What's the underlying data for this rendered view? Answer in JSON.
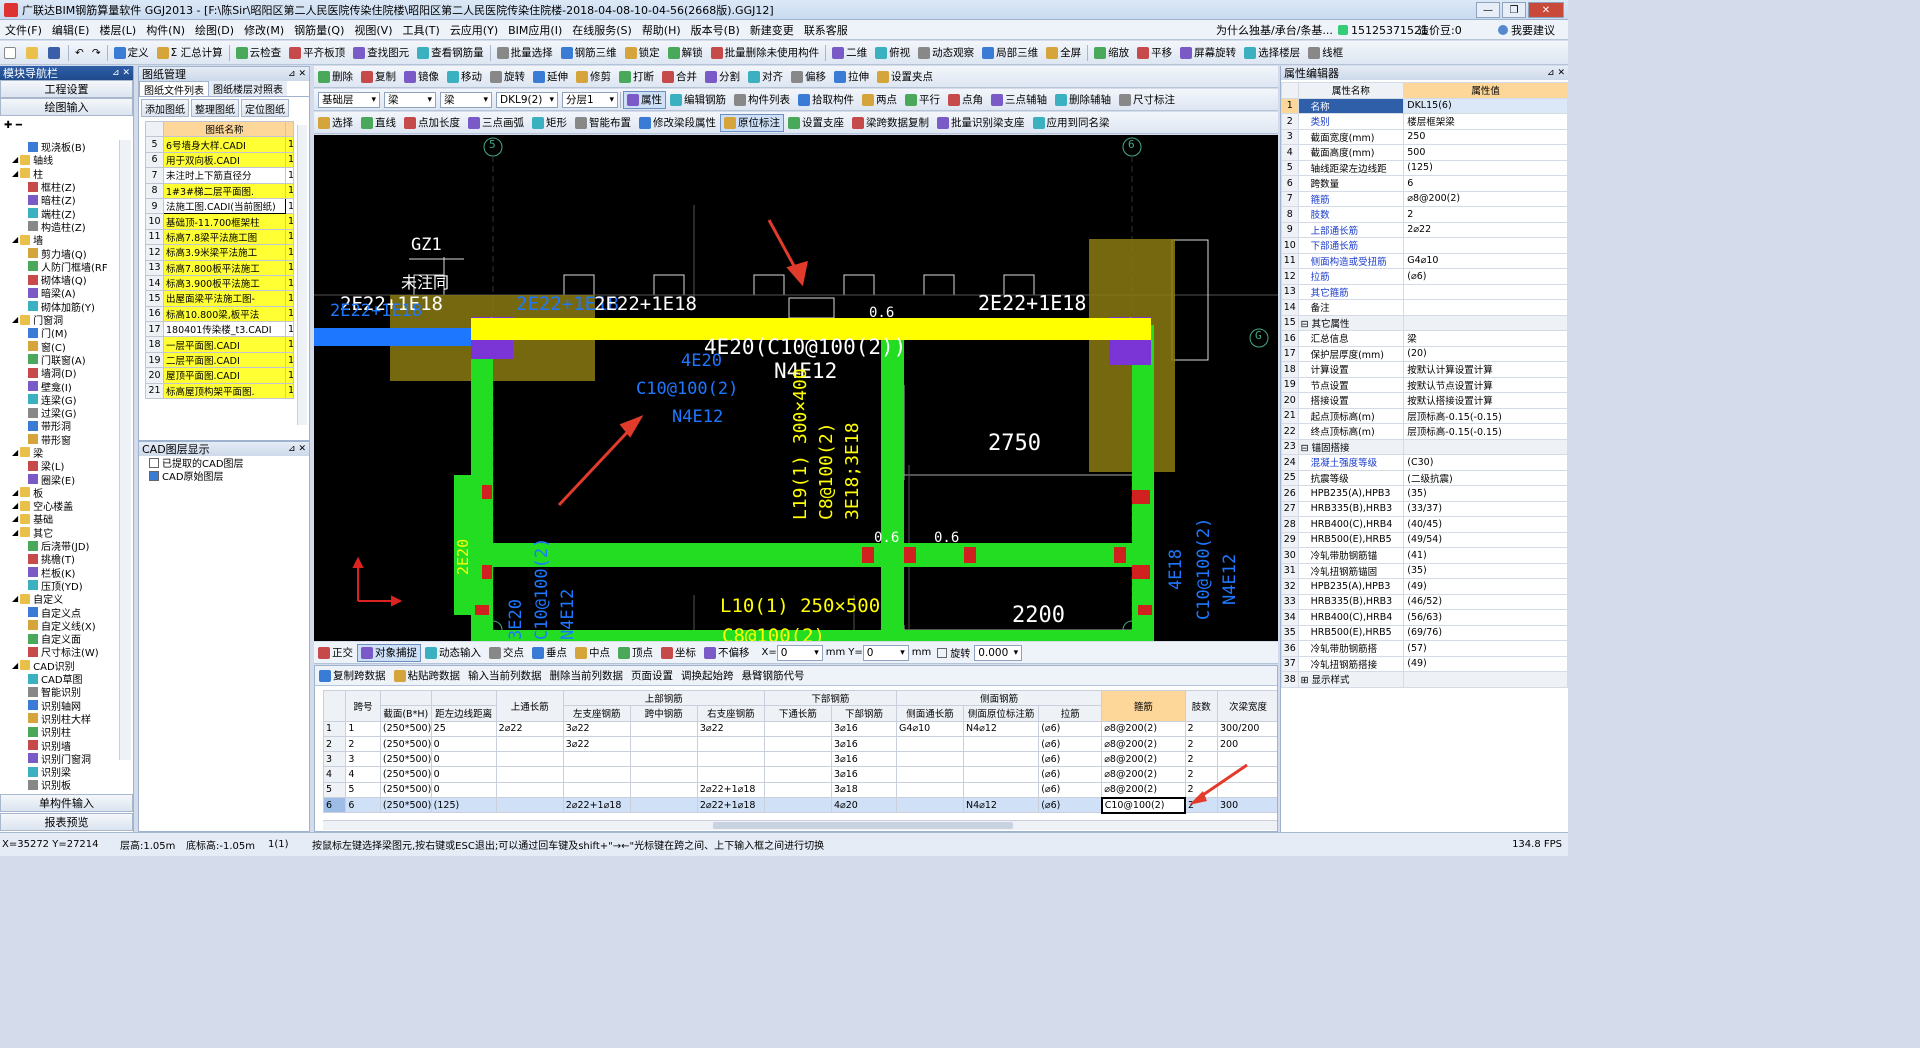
{
  "title": "广联达BIM钢筋算量软件 GGJ2013 - [F:\\陈Sir\\昭阳区第二人民医院传染住院楼\\昭阳区第二人民医院传染住院楼-2018-04-08-10-04-56(2668版).GGJ12]",
  "menu": [
    "文件(F)",
    "编辑(E)",
    "楼层(L)",
    "构件(N)",
    "绘图(D)",
    "修改(M)",
    "钢筋量(Q)",
    "视图(V)",
    "工具(T)",
    "云应用(Y)",
    "BIM应用(I)",
    "在线服务(S)",
    "帮助(H)",
    "版本号(B)",
    "新建变更",
    "联系客服"
  ],
  "menu_right": {
    "ad": "为什么独基/承台/条基...",
    "phone": "15125371521",
    "coin": "造价豆:0",
    "user": "我要建议"
  },
  "toolbar1": [
    "定义",
    "Σ 汇总计算",
    "云检查",
    "平齐板顶",
    "查找图元",
    "查看钢筋量",
    "批量选择",
    "钢筋三维",
    "锁定",
    "解锁",
    "批量删除未使用构件",
    "二维",
    "俯视",
    "动态观察",
    "局部三维",
    "全屏",
    "缩放",
    "平移",
    "屏幕旋转",
    "选择楼层",
    "线框"
  ],
  "left_nav": {
    "title": "模块导航栏",
    "btn_settings": "工程设置",
    "btn_draw": "绘图输入",
    "btn_single": "单构件输入",
    "btn_report": "报表预览",
    "tree": [
      {
        "t": "现浇板(B)",
        "lv": 2
      },
      {
        "t": "轴线",
        "lv": 0
      },
      {
        "t": "柱",
        "lv": 0
      },
      {
        "t": "框柱(Z)",
        "lv": 2
      },
      {
        "t": "暗柱(Z)",
        "lv": 2
      },
      {
        "t": "端柱(Z)",
        "lv": 2
      },
      {
        "t": "构造柱(Z)",
        "lv": 2
      },
      {
        "t": "墙",
        "lv": 0
      },
      {
        "t": "剪力墙(Q)",
        "lv": 2
      },
      {
        "t": "人防门框墙(RF",
        "lv": 2
      },
      {
        "t": "砌体墙(Q)",
        "lv": 2
      },
      {
        "t": "暗梁(A)",
        "lv": 2
      },
      {
        "t": "砌体加筋(Y)",
        "lv": 2
      },
      {
        "t": "门窗洞",
        "lv": 0
      },
      {
        "t": "门(M)",
        "lv": 2
      },
      {
        "t": "窗(C)",
        "lv": 2
      },
      {
        "t": "门联窗(A)",
        "lv": 2
      },
      {
        "t": "墙洞(D)",
        "lv": 2
      },
      {
        "t": "壁龛(I)",
        "lv": 2
      },
      {
        "t": "连梁(G)",
        "lv": 2
      },
      {
        "t": "过梁(G)",
        "lv": 2
      },
      {
        "t": "带形洞",
        "lv": 2
      },
      {
        "t": "带形窗",
        "lv": 2
      },
      {
        "t": "梁",
        "lv": 0
      },
      {
        "t": "梁(L)",
        "lv": 2
      },
      {
        "t": "圈梁(E)",
        "lv": 2
      },
      {
        "t": "板",
        "lv": 0
      },
      {
        "t": "空心楼盖",
        "lv": 0
      },
      {
        "t": "基础",
        "lv": 0
      },
      {
        "t": "其它",
        "lv": 0
      },
      {
        "t": "后浇带(JD)",
        "lv": 2
      },
      {
        "t": "挑檐(T)",
        "lv": 2
      },
      {
        "t": "栏板(K)",
        "lv": 2
      },
      {
        "t": "压顶(YD)",
        "lv": 2
      },
      {
        "t": "自定义",
        "lv": 0
      },
      {
        "t": "自定义点",
        "lv": 2
      },
      {
        "t": "自定义线(X)",
        "lv": 2
      },
      {
        "t": "自定义面",
        "lv": 2
      },
      {
        "t": "尺寸标注(W)",
        "lv": 2
      },
      {
        "t": "CAD识别",
        "lv": 0
      },
      {
        "t": "CAD草图",
        "lv": 2
      },
      {
        "t": "智能识别",
        "lv": 2
      },
      {
        "t": "识别轴网",
        "lv": 2
      },
      {
        "t": "识别柱大样",
        "lv": 2
      },
      {
        "t": "识别柱",
        "lv": 2
      },
      {
        "t": "识别墙",
        "lv": 2
      },
      {
        "t": "识别门窗洞",
        "lv": 2
      },
      {
        "t": "识别梁",
        "lv": 2
      },
      {
        "t": "识别板",
        "lv": 2
      }
    ]
  },
  "drawing_mgr": {
    "title": "图纸管理",
    "tabs": [
      "图纸文件列表",
      "图纸楼层对照表"
    ],
    "buttons": [
      "添加图纸",
      "整理图纸",
      "定位图纸"
    ],
    "header": "图纸名称",
    "rows": [
      {
        "n": "5",
        "name": "6号墙身大样.CADI",
        "y": true
      },
      {
        "n": "6",
        "name": "用于双向板.CADI",
        "y": true
      },
      {
        "n": "7",
        "name": "未注时上下筋直径分",
        "y": false
      },
      {
        "n": "8",
        "name": "1#3#梯二层平面图.",
        "y": true
      },
      {
        "n": "9",
        "name": "法施工图.CADI(当前图纸)",
        "y": false,
        "cur": true
      },
      {
        "n": "10",
        "name": "基础顶-11.700框架柱",
        "y": true
      },
      {
        "n": "11",
        "name": "标高7.8梁平法施工图",
        "y": true
      },
      {
        "n": "12",
        "name": "标高3.9米梁平法施工",
        "y": true
      },
      {
        "n": "13",
        "name": "标高7.800板平法施工",
        "y": true
      },
      {
        "n": "14",
        "name": "标高3.900板平法施工",
        "y": true
      },
      {
        "n": "15",
        "name": "出屋面梁平法施工图-",
        "y": true
      },
      {
        "n": "16",
        "name": "标高10.800梁,板平法",
        "y": true
      },
      {
        "n": "17",
        "name": "180401传染楼_t3.CADI",
        "y": false
      },
      {
        "n": "18",
        "name": "一层平面图.CADI",
        "y": true
      },
      {
        "n": "19",
        "name": "二层平面图.CADI",
        "y": true
      },
      {
        "n": "20",
        "name": "屋顶平面图.CADI",
        "y": true
      },
      {
        "n": "21",
        "name": "标高屋顶构架平面图.",
        "y": true
      }
    ]
  },
  "cad_layers": {
    "title": "CAD图层显示",
    "items": [
      "已提取的CAD图层",
      "CAD原始图层"
    ]
  },
  "toolbar2": {
    "btns": [
      "删除",
      "复制",
      "镜像",
      "移动",
      "旋转",
      "延伸",
      "修剪",
      "打断",
      "合并",
      "分割",
      "对齐",
      "偏移",
      "拉伸",
      "设置夹点"
    ]
  },
  "toolbar3": {
    "floor": "基础层",
    "type1": "梁",
    "type2": "梁",
    "name": "DKL9(2)",
    "layer": "分层1",
    "btns": [
      "属性",
      "编辑钢筋",
      "构件列表",
      "拾取构件",
      "两点",
      "平行",
      "点角",
      "三点辅轴",
      "删除辅轴",
      "尺寸标注"
    ]
  },
  "toolbar4": {
    "btns": [
      "选择",
      "直线",
      "点加长度",
      "三点画弧",
      "矩形",
      "智能布置",
      "修改梁段属性",
      "原位标注",
      "设置支座",
      "梁跨数据复制",
      "批量识别梁支座",
      "应用到同名梁"
    ]
  },
  "canvas_labels": {
    "axis5": "5",
    "axis6": "6",
    "axisG": "G",
    "gz1": "GZ1",
    "weizhu": "未注同",
    "t1": "2E22+1E18",
    "t2": "2E22+1E18",
    "t3": "2E22+1E18",
    "t4": "2E22+1E18",
    "t5": "2E22+1E18",
    "beam_main": "4E20(C10@100(2))",
    "beam_n": "N4E12",
    "blue1": "4E20",
    "blue2": "C10@100(2)",
    "blue3": "N4E12",
    "l19a": "L19(1) 300×400",
    "l19b": "C8@100(2)",
    "l19c": "3E18;3E18",
    "dim1": "2750",
    "dim2": "2200",
    "l10a": "L10(1) 250×500",
    "l10b": "C8@100(2)",
    "vl1": "2E20",
    "vl2": "3E20",
    "vl3": "C10@100(2)",
    "vl4": "N4E12",
    "vr1": "4E18",
    "vr2": "C10@100(2)",
    "vr3": "N4E12",
    "d1": "0.6",
    "d2": "0.6",
    "d3": "0.6"
  },
  "snapbar": {
    "btns": [
      "正交",
      "对象捕捉",
      "动态输入",
      "交点",
      "垂点",
      "中点",
      "顶点",
      "坐标",
      "不偏移"
    ],
    "x": "0",
    "y": "0",
    "mm": "mm",
    "rotate": "旋转",
    "rot_val": "0.000"
  },
  "rebar_toolbar": [
    "复制跨数据",
    "粘贴跨数据",
    "输入当前列数据",
    "删除当前列数据",
    "页面设置",
    "调换起始跨",
    "悬臂钢筋代号"
  ],
  "rebar_table": {
    "h_top": {
      "span": "跨号",
      "upper": "上部钢筋",
      "lower": "下部钢筋",
      "side": "侧面钢筋",
      "stirrup": "箍筋",
      "legs": "肢数",
      "width": "次梁宽度"
    },
    "h_sub": [
      "截面(B*H)",
      "距左边线距离",
      "上通长筋",
      "左支座钢筋",
      "跨中钢筋",
      "右支座钢筋",
      "下通长筋",
      "下部钢筋",
      "侧面通长筋",
      "侧面原位标注筋",
      "拉筋"
    ],
    "rows": [
      {
        "r": "1",
        "s": "1",
        "sec": "(250*500)",
        "dist": "25",
        "top": "2⌀22",
        "left": "3⌀22",
        "mid": "",
        "right": "3⌀22",
        "bt": "",
        "bot": "3⌀16",
        "sidec": "G4⌀10",
        "sideo": "N4⌀12",
        "tie": "(⌀6)",
        "stir": "⌀8@200(2)",
        "legs": "2",
        "w": "300/200"
      },
      {
        "r": "2",
        "s": "2",
        "sec": "(250*500)",
        "dist": "0",
        "top": "",
        "left": "3⌀22",
        "mid": "",
        "right": "",
        "bt": "",
        "bot": "3⌀16",
        "sidec": "",
        "sideo": "",
        "tie": "(⌀6)",
        "stir": "⌀8@200(2)",
        "legs": "2",
        "w": "200"
      },
      {
        "r": "3",
        "s": "3",
        "sec": "(250*500)",
        "dist": "0",
        "top": "",
        "left": "",
        "mid": "",
        "right": "",
        "bt": "",
        "bot": "3⌀16",
        "sidec": "",
        "sideo": "",
        "tie": "(⌀6)",
        "stir": "⌀8@200(2)",
        "legs": "2",
        "w": ""
      },
      {
        "r": "4",
        "s": "4",
        "sec": "(250*500)",
        "dist": "0",
        "top": "",
        "left": "",
        "mid": "",
        "right": "",
        "bt": "",
        "bot": "3⌀16",
        "sidec": "",
        "sideo": "",
        "tie": "(⌀6)",
        "stir": "⌀8@200(2)",
        "legs": "2",
        "w": ""
      },
      {
        "r": "5",
        "s": "5",
        "sec": "(250*500)",
        "dist": "0",
        "top": "",
        "left": "",
        "mid": "",
        "right": "2⌀22+1⌀18",
        "bt": "",
        "bot": "3⌀18",
        "sidec": "",
        "sideo": "",
        "tie": "(⌀6)",
        "stir": "⌀8@200(2)",
        "legs": "2",
        "w": ""
      },
      {
        "r": "6",
        "s": "6",
        "sec": "(250*500)",
        "dist": "(125)",
        "top": "",
        "left": "2⌀22+1⌀18",
        "mid": "",
        "right": "2⌀22+1⌀18",
        "bt": "",
        "bot": "4⌀20",
        "sidec": "",
        "sideo": "N4⌀12",
        "tie": "(⌀6)",
        "stir": "C10@100(2)",
        "legs": "2",
        "w": "300",
        "sel": true
      }
    ]
  },
  "props": {
    "title": "属性编辑器",
    "h_name": "属性名称",
    "h_val": "属性值",
    "rows": [
      {
        "n": "1",
        "k": "名称",
        "v": "DKL15(6)",
        "b": true,
        "sel": true
      },
      {
        "n": "2",
        "k": "类别",
        "v": "楼层框架梁",
        "b": true
      },
      {
        "n": "3",
        "k": "截面宽度(mm)",
        "v": "250",
        "b": false
      },
      {
        "n": "4",
        "k": "截面高度(mm)",
        "v": "500",
        "b": false
      },
      {
        "n": "5",
        "k": "轴线距梁左边线距",
        "v": "(125)",
        "b": false
      },
      {
        "n": "6",
        "k": "跨数量",
        "v": "6",
        "b": false
      },
      {
        "n": "7",
        "k": "箍筋",
        "v": "⌀8@200(2)",
        "b": true
      },
      {
        "n": "8",
        "k": "肢数",
        "v": "2",
        "b": true
      },
      {
        "n": "9",
        "k": "上部通长筋",
        "v": "2⌀22",
        "b": true
      },
      {
        "n": "10",
        "k": "下部通长筋",
        "v": "",
        "b": true
      },
      {
        "n": "11",
        "k": "侧面构造或受扭筋",
        "v": "G4⌀10",
        "b": true
      },
      {
        "n": "12",
        "k": "拉筋",
        "v": "(⌀6)",
        "b": true
      },
      {
        "n": "13",
        "k": "其它箍筋",
        "v": "",
        "b": true
      },
      {
        "n": "14",
        "k": "备注",
        "v": "",
        "b": false
      },
      {
        "n": "15",
        "k": "⊟ 其它属性",
        "v": "",
        "b": false,
        "g": true
      },
      {
        "n": "16",
        "k": "汇总信息",
        "v": "梁",
        "b": false
      },
      {
        "n": "17",
        "k": "保护层厚度(mm)",
        "v": "(20)",
        "b": false
      },
      {
        "n": "18",
        "k": "计算设置",
        "v": "按默认计算设置计算",
        "b": false
      },
      {
        "n": "19",
        "k": "节点设置",
        "v": "按默认节点设置计算",
        "b": false
      },
      {
        "n": "20",
        "k": "搭接设置",
        "v": "按默认搭接设置计算",
        "b": false
      },
      {
        "n": "21",
        "k": "起点顶标高(m)",
        "v": "层顶标高-0.15(-0.15)",
        "b": false
      },
      {
        "n": "22",
        "k": "终点顶标高(m)",
        "v": "层顶标高-0.15(-0.15)",
        "b": false
      },
      {
        "n": "23",
        "k": "⊟ 锚固搭接",
        "v": "",
        "b": false,
        "g": true
      },
      {
        "n": "24",
        "k": "混凝土强度等级",
        "v": "(C30)",
        "b": true
      },
      {
        "n": "25",
        "k": "抗震等级",
        "v": "(二级抗震)",
        "b": false
      },
      {
        "n": "26",
        "k": "HPB235(A),HPB3",
        "v": "(35)",
        "b": false
      },
      {
        "n": "27",
        "k": "HRB335(B),HRB3",
        "v": "(33/37)",
        "b": false
      },
      {
        "n": "28",
        "k": "HRB400(C),HRB4",
        "v": "(40/45)",
        "b": false
      },
      {
        "n": "29",
        "k": "HRB500(E),HRB5",
        "v": "(49/54)",
        "b": false
      },
      {
        "n": "30",
        "k": "冷轧带肋钢筋锚",
        "v": "(41)",
        "b": false
      },
      {
        "n": "31",
        "k": "冷轧扭钢筋锚固",
        "v": "(35)",
        "b": false
      },
      {
        "n": "32",
        "k": "HPB235(A),HPB3",
        "v": "(49)",
        "b": false
      },
      {
        "n": "33",
        "k": "HRB335(B),HRB3",
        "v": "(46/52)",
        "b": false
      },
      {
        "n": "34",
        "k": "HRB400(C),HRB4",
        "v": "(56/63)",
        "b": false
      },
      {
        "n": "35",
        "k": "HRB500(E),HRB5",
        "v": "(69/76)",
        "b": false
      },
      {
        "n": "36",
        "k": "冷轧带肋钢筋搭",
        "v": "(57)",
        "b": false
      },
      {
        "n": "37",
        "k": "冷轧扭钢筋搭接",
        "v": "(49)",
        "b": false
      },
      {
        "n": "38",
        "k": "⊞ 显示样式",
        "v": "",
        "b": false,
        "g": true
      }
    ]
  },
  "status": {
    "coords": "X=35272 Y=27214",
    "floor_h": "层高:1.05m",
    "bottom": "底标高:-1.05m",
    "count": "1(1)",
    "hint": "按鼠标左键选择梁图元,按右键或ESC退出;可以通过回车键及shift+\"→←\"光标键在跨之间、上下输入框之间进行切换",
    "fps": "134.8 FPS"
  },
  "colors": {
    "canvas_bg": "#000000",
    "beam_yellow": "#ffff00",
    "beam_green": "#22dd22",
    "arrow_red": "#e23b2b",
    "blue_beam": "#1e78ff",
    "header_blue": "#1f4a8c"
  }
}
